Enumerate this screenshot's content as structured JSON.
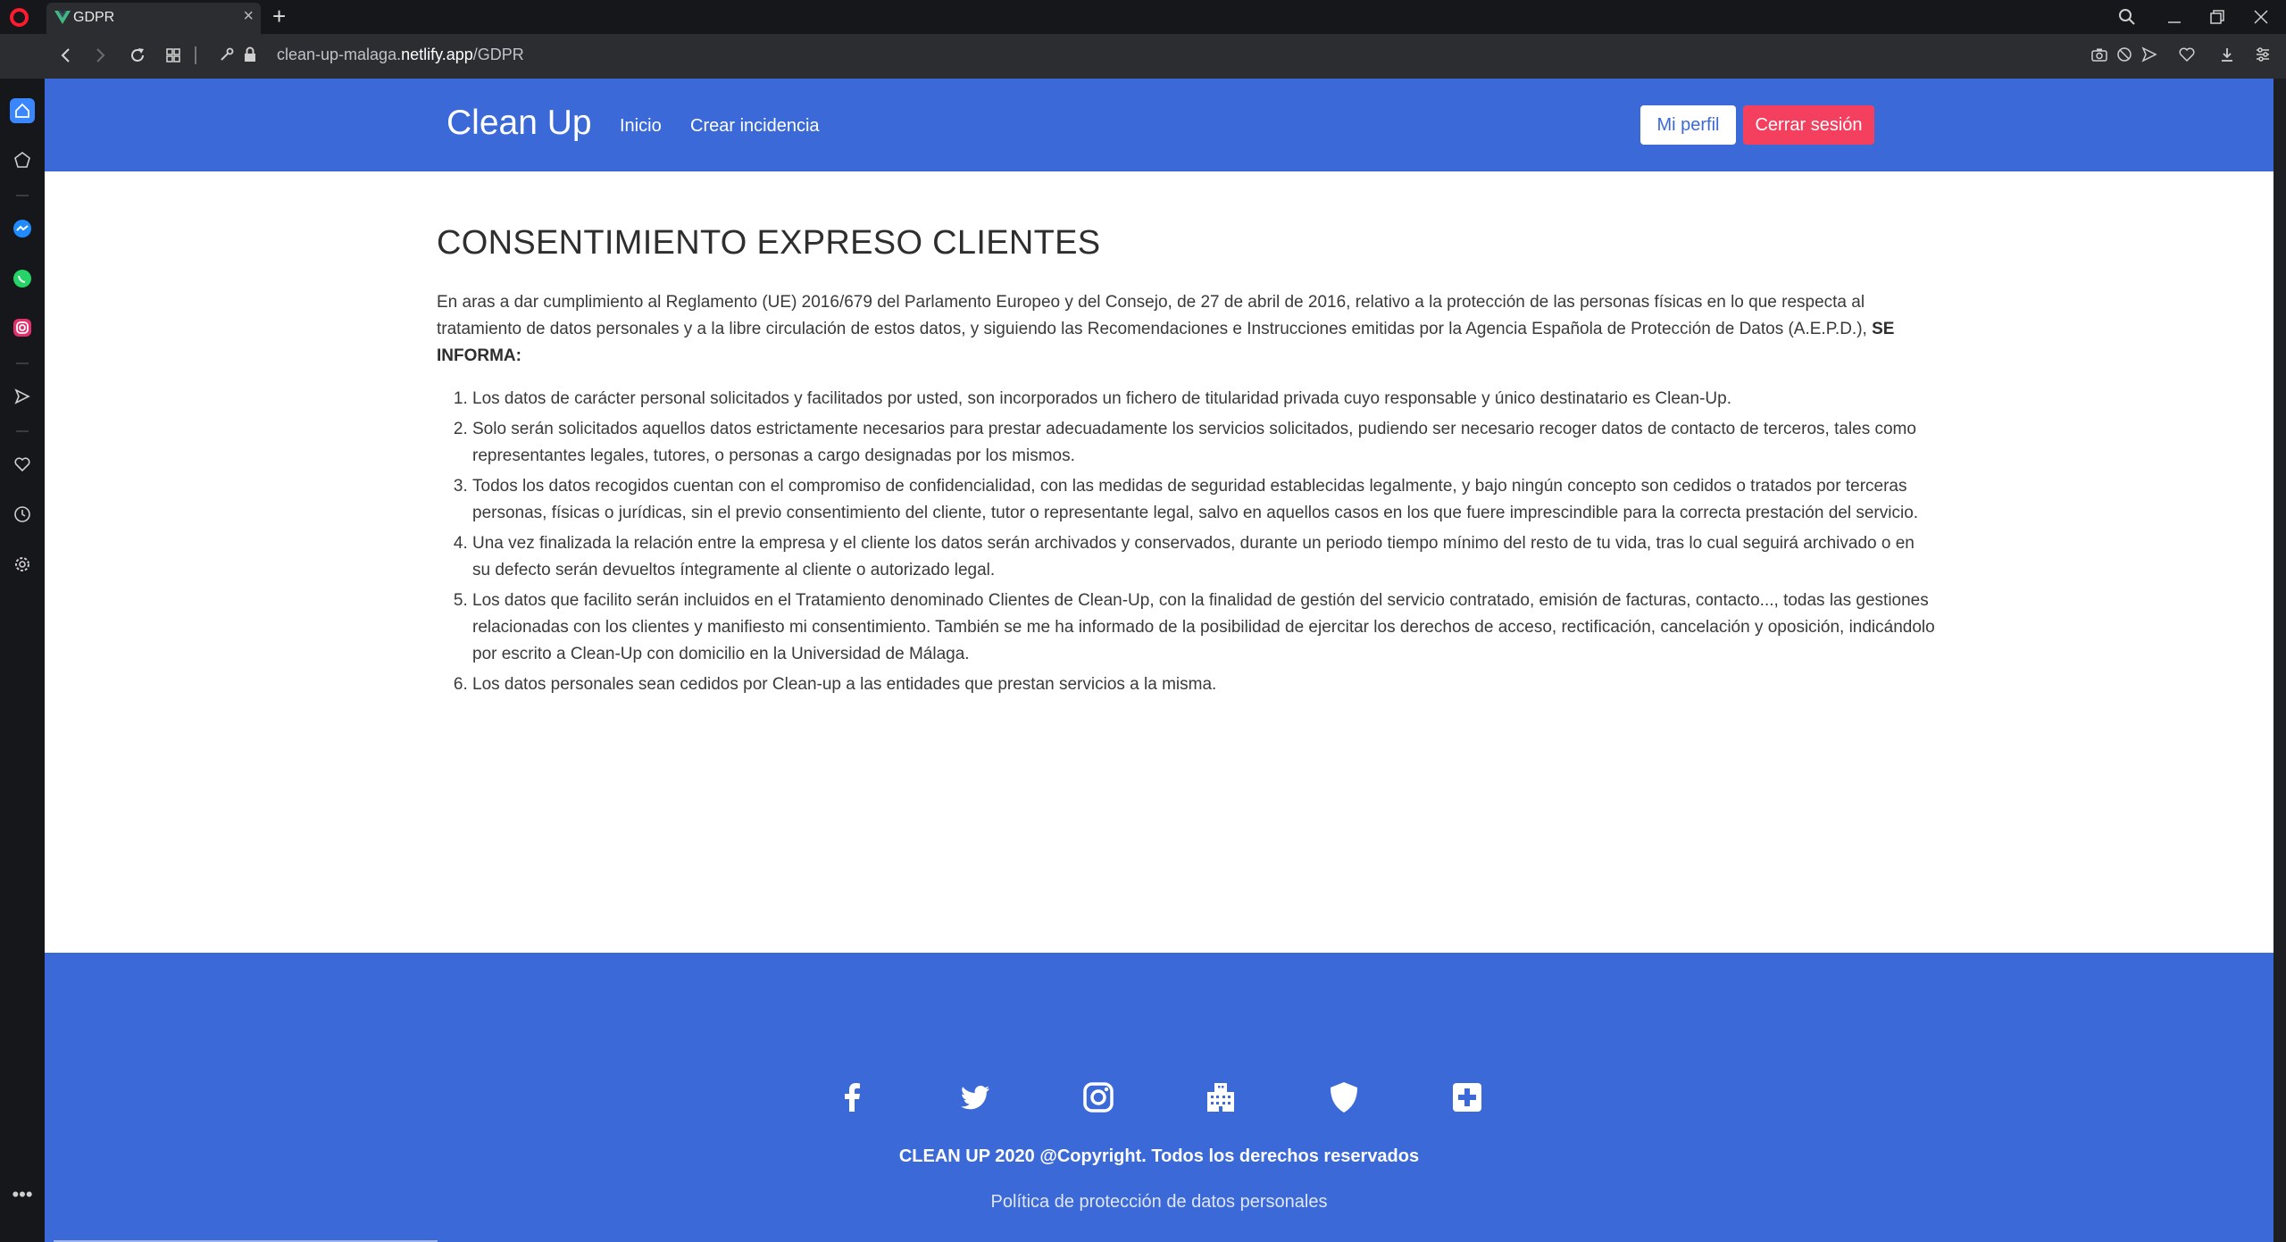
{
  "browser": {
    "tab_title": "GDPR",
    "url_host_prefix": "clean-up-malaga.",
    "url_host_main": "netlify.app",
    "url_path": "/GDPR"
  },
  "nav": {
    "brand": "Clean Up",
    "links": [
      "Inicio",
      "Crear incidencia"
    ],
    "profile_button": "Mi perfil",
    "logout_button": "Cerrar sesión"
  },
  "main": {
    "title": "CONSENTIMIENTO EXPRESO CLIENTES",
    "intro": "En aras a dar cumplimiento al Reglamento (UE) 2016/679 del Parlamento Europeo y del Consejo, de 27 de abril de 2016, relativo a la protección de las personas físicas en lo que respecta al tratamiento de datos personales y a la libre circulación de estos datos, y siguiendo las Recomendaciones e Instrucciones emitidas por la Agencia Española de Protección de Datos (A.E.P.D.),",
    "intro_bold": "SE INFORMA:",
    "items": [
      "Los datos de carácter personal solicitados y facilitados por usted, son incorporados un fichero de titularidad privada cuyo responsable y único destinatario es Clean-Up.",
      "Solo serán solicitados aquellos datos estrictamente necesarios para prestar adecuadamente los servicios solicitados, pudiendo ser necesario recoger datos de contacto de terceros, tales como representantes legales, tutores, o personas a cargo designadas por los mismos.",
      "Todos los datos recogidos cuentan con el compromiso de confidencialidad, con las medidas de seguridad establecidas legalmente, y bajo ningún concepto son cedidos o tratados por terceras personas, físicas o jurídicas, sin el previo consentimiento del cliente, tutor o representante legal, salvo en aquellos casos en los que fuere imprescindible para la correcta prestación del servicio.",
      "Una vez finalizada la relación entre la empresa y el cliente los datos serán archivados y conservados, durante un periodo tiempo mínimo del resto de tu vida, tras lo cual seguirá archivado o en su defecto serán devueltos íntegramente al cliente o autorizado legal.",
      "Los datos que facilito serán incluidos en el Tratamiento denominado Clientes de Clean-Up, con la finalidad de gestión del servicio contratado, emisión de facturas, contacto..., todas las gestiones relacionadas con los clientes y manifiesto mi consentimiento. También se me ha informado de la posibilidad de ejercitar los derechos de acceso, rectificación, cancelación y oposición, indicándolo por escrito a Clean-Up con domicilio en la Universidad de Málaga.",
      "Los datos personales sean cedidos por Clean-up a las entidades que prestan servicios a la misma."
    ]
  },
  "footer": {
    "icons": [
      "facebook-icon",
      "twitter-icon",
      "instagram-icon",
      "building-icon",
      "shield-icon",
      "medical-plus-icon"
    ],
    "copyright": "CLEAN UP 2020 @Copyright. Todos los derechos reservados",
    "policy_link": "Política de protección de datos personales"
  },
  "colors": {
    "brand_blue": "#3b69d8",
    "logout_red": "#f43f5e"
  }
}
